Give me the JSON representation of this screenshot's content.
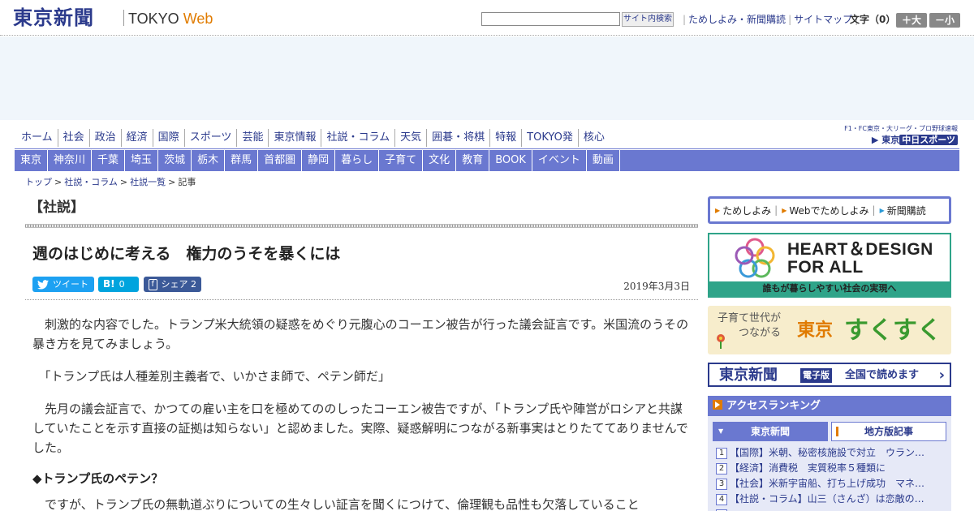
{
  "header": {
    "logo_jp": "東京新聞",
    "logo_tokyo": "TOKYO",
    "logo_web": "Web",
    "search_value": "",
    "search_button": "サイト内検索",
    "links": [
      "ためしよみ・新聞購読",
      "サイトマップ"
    ],
    "font_label": "文字（0）",
    "font_bigger": "＋大",
    "font_smaller": "－小"
  },
  "nav_primary": [
    "ホーム",
    "社会",
    "政治",
    "経済",
    "国際",
    "スポーツ",
    "芸能",
    "東京情報",
    "社説・コラム",
    "天気",
    "囲碁・将棋",
    "特報",
    "TOKYO発",
    "核心"
  ],
  "chunichi": {
    "top_text": "F1・FC東京・大リーグ・プロ野球速報",
    "logo_pre": "▶ 東京",
    "logo_sports": "中日スポーツ"
  },
  "nav_secondary": [
    "東京",
    "神奈川",
    "千葉",
    "埼玉",
    "茨城",
    "栃木",
    "群馬",
    "首都圏",
    "静岡",
    "暮らし",
    "子育て",
    "文化",
    "教育",
    "BOOK",
    "イベント",
    "動画"
  ],
  "breadcrumb": [
    "トップ",
    "社説・コラム",
    "社説一覧",
    "記事"
  ],
  "article": {
    "section": "【社説】",
    "title": "週のはじめに考える　権力のうそを暴くには",
    "share_tweet": "ツイート",
    "share_hatena_count": "0",
    "share_fb": "シェア",
    "share_fb_count": "2",
    "date": "2019年3月3日",
    "paragraphs": [
      "刺激的な内容でした。トランプ米大統領の疑惑をめぐり元腹心のコーエン被告が行った議会証言です。米国流のうその暴き方を見てみましょう。",
      "「トランプ氏は人種差別主義者で、いかさま師で、ペテン師だ」",
      "先月の議会証言で、かつての雇い主を口を極めてののしったコーエン被告ですが、「トランプ氏や陣営がロシアと共謀していたことを示す直接の証拠は知らない」と認めました。実際、疑惑解明につながる新事実はとりたててありませんでした。"
    ],
    "subhead": "◆トランプ氏のペテン？",
    "paragraph_4": "ですが、トランプ氏の無軌道ぶりについての生々しい証言を聞くにつけて、倫理観も品性も欠落していること"
  },
  "sidebar": {
    "links": [
      "ためしよみ",
      "Webでためしよみ",
      "新聞購読"
    ],
    "hd_line1": "HEART＆DESIGN",
    "hd_line2": "FOR ALL",
    "hd_foot": "誰もが暮らしやすい社会の実現へ",
    "sk_small1": "子育て世代が",
    "sk_small2": "つながる",
    "sk_tokyo": "東京",
    "sk_main": "すくすく",
    "ep_logo": "東京新聞",
    "ep_tag": "電子版",
    "ep_read": "全国で読めます",
    "ep_arrow": "›",
    "ranking_title": "アクセスランキング",
    "tab_a": "東京新聞",
    "tab_b": "地方版記事",
    "ranking": [
      {
        "num": "1",
        "text": "【国際】米朝、秘密核施設で対立　ウラン…"
      },
      {
        "num": "2",
        "text": "【経済】消費税　実質税率５種類に"
      },
      {
        "num": "3",
        "text": "【社会】米新宇宙船、打ち上げ成功　マネ…"
      },
      {
        "num": "4",
        "text": "【社説・コラム】山三（さんざ）は恋敵の…"
      },
      {
        "num": "5",
        "text": ""
      }
    ]
  }
}
